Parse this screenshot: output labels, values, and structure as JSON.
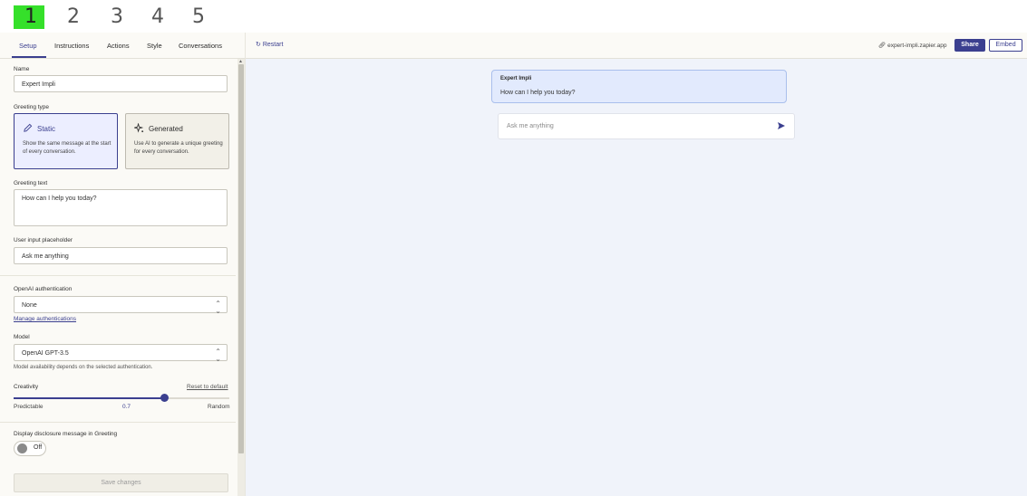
{
  "steps": [
    "1",
    "2",
    "3",
    "4",
    "5"
  ],
  "tabs": [
    "Setup",
    "Instructions",
    "Actions",
    "Style",
    "Conversations"
  ],
  "form": {
    "name_label": "Name",
    "name_value": "Expert Impli",
    "greeting_type_label": "Greeting type",
    "static_title": "Static",
    "static_desc": "Show the same message at the start of every conversation.",
    "generated_title": "Generated",
    "generated_desc": "Use AI to generate a unique greeting for every conversation.",
    "greeting_text_label": "Greeting text",
    "greeting_text_value": "How can I help you today?",
    "placeholder_label": "User input placeholder",
    "placeholder_value": "Ask me anything",
    "auth_label": "OpenAI authentication",
    "auth_value": "None",
    "manage_auth_link": "Manage authentications",
    "model_label": "Model",
    "model_value": "OpenAI GPT-3.5",
    "model_hint": "Model availability depends on the selected authentication.",
    "creativity_label": "Creativity",
    "reset_link": "Reset to default",
    "creativity_value": "0.7",
    "creativity_fraction": 0.7,
    "creativity_min_label": "Predictable",
    "creativity_max_label": "Random",
    "disclosure_label": "Display disclosure message in Greeting",
    "toggle_label": "Off",
    "save_label": "Save changes"
  },
  "preview": {
    "restart_label": "Restart",
    "share_url": "expert-impli.zapier.app",
    "share_label": "Share",
    "embed_label": "Embed",
    "bot_name": "Expert Impli",
    "greeting": "How can I help you today?",
    "input_placeholder": "Ask me anything"
  },
  "colors": {
    "accent": "#3b3f8f",
    "step_highlight": "#35e02a",
    "preview_bg": "#f0f3fa",
    "bubble_bg": "#e2eafd"
  }
}
